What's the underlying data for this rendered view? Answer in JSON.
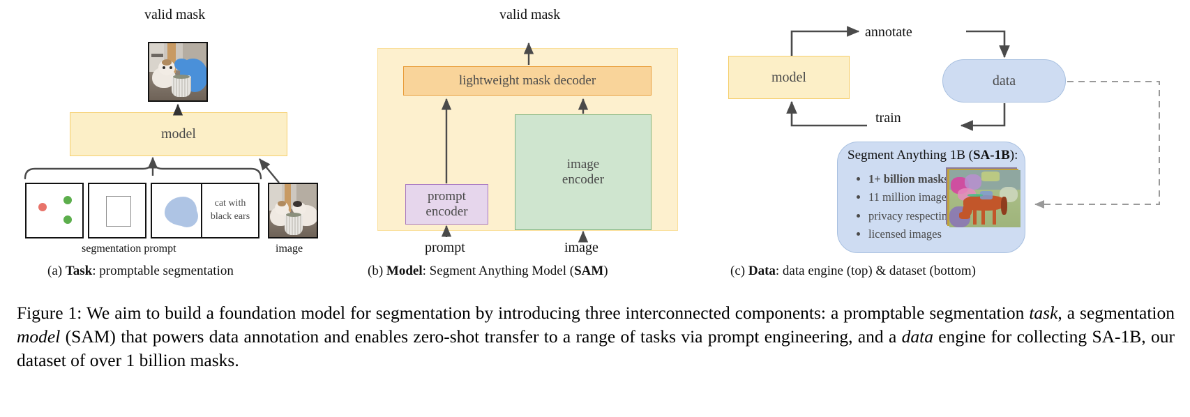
{
  "figure": {
    "label": "Figure 1:",
    "caption_text": "Figure 1: We aim to build a foundation model for segmentation by introducing three interconnected components: a promptable segmentation task, a segmentation model (SAM) that powers data annotation and enables zero-shot transfer to a range of tasks via prompt engineering, and a data engine for collecting SA-1B, our dataset of over 1 billion masks.",
    "caption_parts": {
      "p1": "Figure 1: We aim to build a foundation model for segmentation by introducing three interconnected components: a promptable segmentation ",
      "i1": "task",
      "p2": ", a segmentation ",
      "i2": "model",
      "p3": " (SAM) that powers data annotation and enables zero-shot transfer to a range of tasks via prompt engineering, and a ",
      "i3": "data",
      "p4": " engine for collecting SA-1B, our dataset of over 1 billion masks."
    }
  },
  "panel_a": {
    "subcaption_prefix": "(a) ",
    "subcaption_bold": "Task",
    "subcaption_suffix": ": promptable segmentation",
    "output_label": "valid mask",
    "model_label": "model",
    "prompt_group_label": "segmentation prompt",
    "image_label": "image",
    "prompts": [
      {
        "name": "points-prompt",
        "kind": "points"
      },
      {
        "name": "box-prompt",
        "kind": "box"
      },
      {
        "name": "mask-prompt",
        "kind": "mask"
      },
      {
        "name": "text-prompt",
        "kind": "text",
        "line1": "cat with",
        "line2": "black ears"
      }
    ],
    "point_colors": {
      "negative": "#E8736A",
      "positive": "#5CAE4C"
    }
  },
  "panel_b": {
    "subcaption_prefix": "(b) ",
    "subcaption_bold": "Model",
    "subcaption_mid": ": Segment Anything Model (",
    "subcaption_bold2": "SAM",
    "subcaption_suffix": ")",
    "output_label": "valid mask",
    "decoder_label": "lightweight mask decoder",
    "image_encoder_label_1": "image",
    "image_encoder_label_2": "encoder",
    "prompt_encoder_label_1": "prompt",
    "prompt_encoder_label_2": "encoder",
    "input_prompt_label": "prompt",
    "input_image_label": "image"
  },
  "panel_c": {
    "subcaption_prefix": "(c) ",
    "subcaption_bold": "Data",
    "subcaption_suffix": ": data engine (top) & dataset (bottom)",
    "model_label": "model",
    "data_label": "data",
    "annotate_label": "annotate",
    "train_label": "train",
    "dataset_title_prefix": "Segment Anything 1B (",
    "dataset_title_bold": "SA-1B",
    "dataset_title_suffix": "):",
    "bullets": [
      {
        "text": "1+ billion masks",
        "bold": true
      },
      {
        "text": "11 million images",
        "bold": false
      },
      {
        "text": "privacy respecting",
        "bold": false
      },
      {
        "text": "licensed images",
        "bold": false
      }
    ]
  },
  "colors": {
    "yellow_fill": "#FCEFC7",
    "yellow_border": "#F5CE6B",
    "yellow_container_fill": "#FDF0CE",
    "orange_fill": "#F9D49A",
    "orange_border": "#E89B37",
    "green_fill": "#CFE5CF",
    "green_border": "#7FB47F",
    "purple_fill": "#E6D6EC",
    "purple_border": "#A878C0",
    "blue_fill": "#CEDCF2",
    "blue_border": "#A8C0E0",
    "arrow": "#4a4a4a",
    "text_grey": "#4a4a4a"
  }
}
